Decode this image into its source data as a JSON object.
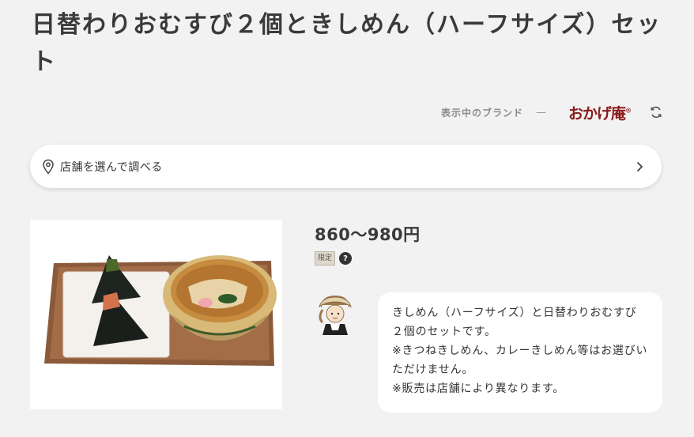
{
  "product": {
    "title": "日替わりおむすび２個ときしめん（ハーフサイズ）セット",
    "price": "860〜980円",
    "badge": "限定",
    "help_symbol": "?",
    "description": [
      "きしめん（ハーフサイズ）と日替わりおむすび２個のセットです。",
      "※きつねきしめん、カレーきしめん等はお選びいただけません。",
      "※販売は店舗により異なります。"
    ]
  },
  "brand": {
    "label": "表示中のブランド",
    "separator": "—",
    "logo_text": "おかげ庵",
    "logo_mark": "®",
    "logo_color": "#8b1a1a"
  },
  "store_search": {
    "label": "店舗を選んで調べる"
  },
  "icons": {
    "location": "map-pin-icon",
    "chevron": "chevron-right-icon",
    "refresh": "refresh-icon",
    "help": "question-icon"
  }
}
